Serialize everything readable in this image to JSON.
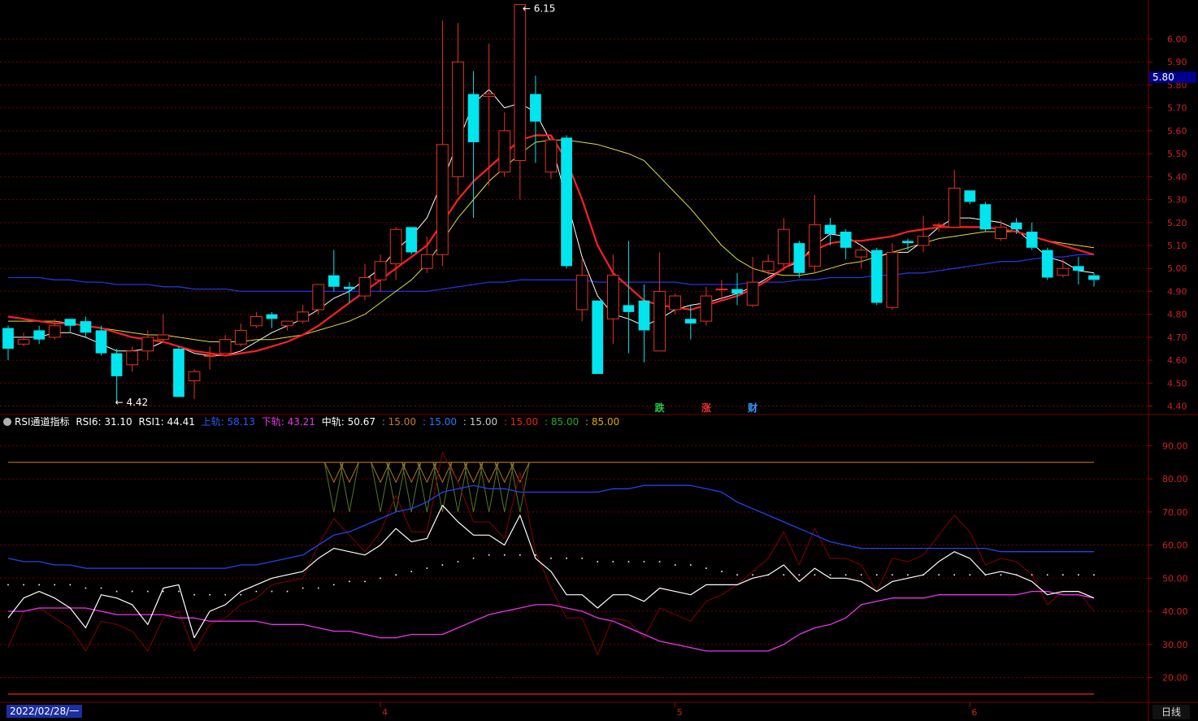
{
  "main": {
    "high_label": "6.15",
    "low_label": "4.42",
    "current_price": "5.80",
    "markers": [
      {
        "text": "跌",
        "color": "#22cc44",
        "index": 42
      },
      {
        "text": "涨",
        "color": "#ee3333",
        "index": 45
      },
      {
        "text": "财",
        "color": "#3399ff",
        "index": 48
      }
    ]
  },
  "indicator": {
    "name": "RSI通道指标",
    "rsi6_label": "RSI6: 31.10",
    "rsi1_label": "RSI1: 44.41",
    "upper_label": "上轨: 58.13",
    "lower_label": "下轨: 43.21",
    "mid_label": "中轨: 50.67",
    "v1": ": 15.00",
    "v2": ": 15.00",
    "v3": ": 15.00",
    "v4": ": 15.00",
    "v5": ": 85.00",
    "v6": ": 85.00"
  },
  "footer": {
    "date": "2022/02/28/一",
    "period": "日线"
  },
  "colors": {
    "up": "#e8331f",
    "down": "#00e5ee",
    "ma_white": "#ffffff",
    "ma_yellow": "#dddd44",
    "ma_red": "#ff2020",
    "ma_blue": "#2233dd",
    "rsi_upper": "#2244ee",
    "rsi_lower": "#ee33ee",
    "rsi6": "#880000",
    "level_85": "#cc8800",
    "grid": "#7a0000"
  },
  "chart_data": [
    {
      "type": "candlestick",
      "y_axis_ticks": [
        "4.40",
        "4.50",
        "4.60",
        "4.70",
        "4.80",
        "4.90",
        "5.00",
        "5.10",
        "5.20",
        "5.30",
        "5.40",
        "5.50",
        "5.60",
        "5.70",
        "5.80",
        "5.90",
        "6.00"
      ],
      "ylim": [
        4.37,
        6.17
      ],
      "x_tick_labels": [
        {
          "label": "4",
          "index": 24
        },
        {
          "label": "5",
          "index": 43
        },
        {
          "label": "6",
          "index": 62
        }
      ],
      "candles": [
        [
          4.74,
          4.65,
          4.75,
          4.6
        ],
        [
          4.67,
          4.69,
          4.72,
          4.66
        ],
        [
          4.73,
          4.69,
          4.75,
          4.67
        ],
        [
          4.7,
          4.75,
          4.78,
          4.69
        ],
        [
          4.78,
          4.75,
          4.78,
          4.72
        ],
        [
          4.77,
          4.72,
          4.79,
          4.7
        ],
        [
          4.73,
          4.63,
          4.75,
          4.62
        ],
        [
          4.63,
          4.53,
          4.65,
          4.42
        ],
        [
          4.58,
          4.64,
          4.66,
          4.55
        ],
        [
          4.64,
          4.7,
          4.73,
          4.6
        ],
        [
          4.69,
          4.71,
          4.8,
          4.68
        ],
        [
          4.65,
          4.44,
          4.66,
          4.44
        ],
        [
          4.51,
          4.55,
          4.56,
          4.43
        ],
        [
          4.62,
          4.62,
          4.66,
          4.56
        ],
        [
          4.63,
          4.69,
          4.71,
          4.63
        ],
        [
          4.67,
          4.73,
          4.76,
          4.66
        ],
        [
          4.75,
          4.79,
          4.81,
          4.74
        ],
        [
          4.8,
          4.78,
          4.81,
          4.74
        ],
        [
          4.75,
          4.77,
          4.77,
          4.73
        ],
        [
          4.77,
          4.81,
          4.84,
          4.76
        ],
        [
          4.82,
          4.93,
          4.93,
          4.8
        ],
        [
          4.97,
          4.92,
          5.08,
          4.9
        ],
        [
          4.92,
          4.91,
          4.94,
          4.85
        ],
        [
          4.88,
          4.96,
          5.02,
          4.86
        ],
        [
          4.95,
          5.03,
          5.06,
          4.9
        ],
        [
          5.02,
          5.17,
          5.18,
          4.95
        ],
        [
          5.18,
          5.07,
          5.18,
          5.06
        ],
        [
          5.0,
          5.06,
          5.14,
          4.98
        ],
        [
          5.06,
          5.54,
          6.08,
          5.01
        ],
        [
          5.4,
          5.9,
          6.07,
          5.32
        ],
        [
          5.76,
          5.55,
          5.86,
          5.22
        ],
        [
          5.75,
          5.76,
          5.98,
          5.36
        ],
        [
          5.42,
          5.6,
          5.68,
          5.4
        ],
        [
          5.47,
          6.15,
          6.15,
          5.3
        ],
        [
          5.76,
          5.64,
          5.84,
          5.46
        ],
        [
          5.42,
          5.56,
          5.58,
          5.39
        ],
        [
          5.57,
          5.01,
          5.58,
          5.0
        ],
        [
          4.82,
          4.97,
          5.04,
          4.77
        ],
        [
          4.86,
          4.54,
          4.86,
          4.54
        ],
        [
          4.78,
          4.97,
          5.06,
          4.67
        ],
        [
          4.84,
          4.81,
          5.12,
          4.63
        ],
        [
          4.86,
          4.73,
          4.93,
          4.59
        ],
        [
          4.64,
          4.9,
          5.07,
          4.64
        ],
        [
          4.82,
          4.88,
          4.89,
          4.8
        ],
        [
          4.78,
          4.76,
          4.84,
          4.69
        ],
        [
          4.77,
          4.88,
          4.92,
          4.75
        ],
        [
          4.91,
          4.91,
          4.95,
          4.86
        ],
        [
          4.91,
          4.89,
          4.98,
          4.84
        ],
        [
          4.84,
          4.94,
          5.05,
          4.83
        ],
        [
          4.99,
          5.03,
          5.06,
          4.97
        ],
        [
          5.02,
          5.17,
          5.22,
          4.99
        ],
        [
          5.11,
          4.98,
          5.12,
          4.96
        ],
        [
          5.01,
          5.19,
          5.32,
          4.98
        ],
        [
          5.19,
          5.15,
          5.22,
          5.1
        ],
        [
          5.16,
          5.09,
          5.17,
          5.04
        ],
        [
          5.05,
          5.08,
          5.1,
          5.0
        ],
        [
          5.08,
          4.85,
          5.09,
          4.84
        ],
        [
          4.83,
          5.07,
          5.11,
          4.82
        ],
        [
          5.12,
          5.11,
          5.13,
          5.08
        ],
        [
          5.1,
          5.14,
          5.23,
          5.07
        ],
        [
          5.19,
          5.19,
          5.2,
          5.16
        ],
        [
          5.18,
          5.35,
          5.43,
          5.18
        ],
        [
          5.34,
          5.29,
          5.34,
          5.28
        ],
        [
          5.28,
          5.17,
          5.29,
          5.16
        ],
        [
          5.13,
          5.18,
          5.21,
          5.12
        ],
        [
          5.2,
          5.17,
          5.22,
          5.15
        ],
        [
          5.16,
          5.09,
          5.2,
          5.08
        ],
        [
          5.08,
          4.96,
          5.09,
          4.95
        ],
        [
          4.97,
          5.0,
          5.04,
          4.96
        ],
        [
          5.01,
          4.99,
          5.05,
          4.93
        ],
        [
          4.97,
          4.95,
          4.98,
          4.92
        ]
      ],
      "ma_white": [
        4.7,
        4.7,
        4.7,
        4.72,
        4.72,
        4.7,
        4.67,
        4.64,
        4.64,
        4.65,
        4.68,
        4.66,
        4.63,
        4.62,
        4.62,
        4.64,
        4.68,
        4.72,
        4.75,
        4.78,
        4.82,
        4.87,
        4.9,
        4.95,
        5.0,
        5.08,
        5.14,
        5.22,
        5.38,
        5.55,
        5.72,
        5.78,
        5.7,
        5.72,
        5.68,
        5.55,
        5.3,
        5.05,
        4.88,
        4.8,
        4.78,
        4.75,
        4.78,
        4.82,
        4.84,
        4.85,
        4.87,
        4.89,
        4.92,
        4.96,
        5.0,
        5.03,
        5.1,
        5.15,
        5.14,
        5.1,
        5.05,
        5.07,
        5.07,
        5.12,
        5.18,
        5.22,
        5.22,
        5.21,
        5.2,
        5.17,
        5.11,
        5.05,
        5.03,
        4.99,
        4.98
      ],
      "ma_yellow": [
        4.77,
        4.77,
        4.77,
        4.77,
        4.76,
        4.75,
        4.74,
        4.73,
        4.72,
        4.71,
        4.71,
        4.7,
        4.69,
        4.68,
        4.68,
        4.68,
        4.69,
        4.69,
        4.7,
        4.71,
        4.73,
        4.75,
        4.77,
        4.8,
        4.85,
        4.9,
        4.95,
        5.02,
        5.12,
        5.22,
        5.3,
        5.38,
        5.44,
        5.5,
        5.55,
        5.56,
        5.56,
        5.55,
        5.54,
        5.52,
        5.5,
        5.47,
        5.4,
        5.33,
        5.26,
        5.18,
        5.1,
        5.04,
        5.0,
        4.98,
        4.97,
        4.97,
        4.98,
        5.0,
        5.02,
        5.03,
        5.05,
        5.07,
        5.09,
        5.11,
        5.13,
        5.14,
        5.15,
        5.16,
        5.16,
        5.16,
        5.14,
        5.12,
        5.11,
        5.1,
        5.09
      ],
      "ma_red": [
        4.79,
        4.78,
        4.77,
        4.76,
        4.76,
        4.75,
        4.74,
        4.72,
        4.7,
        4.69,
        4.68,
        4.66,
        4.64,
        4.63,
        4.62,
        4.63,
        4.64,
        4.66,
        4.68,
        4.71,
        4.75,
        4.8,
        4.85,
        4.9,
        4.95,
        5.0,
        5.05,
        5.1,
        5.2,
        5.3,
        5.38,
        5.44,
        5.5,
        5.56,
        5.58,
        5.58,
        5.47,
        5.3,
        5.1,
        4.98,
        4.92,
        4.86,
        4.84,
        4.83,
        4.82,
        4.84,
        4.86,
        4.88,
        4.91,
        4.95,
        5.0,
        5.04,
        5.08,
        5.11,
        5.12,
        5.12,
        5.13,
        5.14,
        5.16,
        5.17,
        5.18,
        5.18,
        5.18,
        5.18,
        5.17,
        5.16,
        5.14,
        5.12,
        5.1,
        5.08,
        5.06
      ],
      "ma_blue": [
        4.96,
        4.96,
        4.96,
        4.95,
        4.95,
        4.94,
        4.94,
        4.93,
        4.93,
        4.93,
        4.92,
        4.92,
        4.91,
        4.91,
        4.91,
        4.9,
        4.9,
        4.9,
        4.9,
        4.9,
        4.9,
        4.9,
        4.9,
        4.9,
        4.9,
        4.9,
        4.9,
        4.9,
        4.91,
        4.92,
        4.93,
        4.94,
        4.94,
        4.95,
        4.95,
        4.95,
        4.95,
        4.95,
        4.94,
        4.94,
        4.94,
        4.94,
        4.94,
        4.94,
        4.93,
        4.93,
        4.93,
        4.93,
        4.94,
        4.94,
        4.94,
        4.95,
        4.95,
        4.96,
        4.96,
        4.96,
        4.97,
        4.97,
        4.98,
        4.98,
        4.99,
        5.0,
        5.01,
        5.02,
        5.03,
        5.03,
        5.04,
        5.05,
        5.05,
        5.06,
        5.06
      ]
    },
    {
      "type": "line",
      "name": "RSI通道指标",
      "y_axis_ticks": [
        "20.00",
        "30.00",
        "40.00",
        "50.00",
        "60.00",
        "70.00",
        "80.00",
        "90.00"
      ],
      "ylim": [
        13,
        95
      ],
      "rsi1": [
        38,
        44,
        46,
        44,
        41,
        35,
        45,
        44,
        42,
        36,
        47,
        48,
        32,
        40,
        42,
        46,
        48,
        50,
        51,
        52,
        56,
        59,
        58,
        57,
        60,
        65,
        61,
        62,
        72,
        67,
        63,
        63,
        60,
        69,
        56,
        52,
        45,
        45,
        41,
        45,
        45,
        43,
        47,
        46,
        45,
        48,
        48,
        48,
        50,
        51,
        54,
        49,
        53,
        50,
        50,
        49,
        46,
        49,
        50,
        51,
        55,
        58,
        56,
        51,
        52,
        51,
        49,
        45,
        46,
        46,
        44
      ],
      "rsi6": [
        29,
        40,
        41,
        38,
        35,
        28,
        37,
        36,
        34,
        28,
        38,
        40,
        28,
        36,
        38,
        42,
        44,
        48,
        49,
        50,
        60,
        68,
        63,
        58,
        64,
        75,
        64,
        64,
        88,
        79,
        67,
        67,
        62,
        82,
        58,
        47,
        38,
        38,
        27,
        38,
        37,
        32,
        41,
        39,
        37,
        43,
        45,
        48,
        52,
        56,
        64,
        54,
        65,
        56,
        56,
        54,
        46,
        56,
        55,
        57,
        63,
        69,
        64,
        54,
        56,
        55,
        51,
        42,
        46,
        46,
        40
      ],
      "upper": [
        56,
        55,
        55,
        54,
        54,
        53,
        53,
        53,
        53,
        53,
        53,
        53,
        53,
        53,
        53,
        54,
        54,
        55,
        56,
        57,
        60,
        63,
        64,
        66,
        68,
        70,
        71,
        73,
        76,
        77,
        78,
        77,
        77,
        76,
        76,
        76,
        76,
        76,
        76,
        77,
        77,
        78,
        78,
        78,
        78,
        77,
        76,
        73,
        71,
        69,
        67,
        65,
        63,
        61,
        60,
        59,
        59,
        59,
        59,
        59,
        59,
        59,
        59,
        59,
        58,
        58,
        58,
        58,
        58,
        58,
        58
      ],
      "lower": [
        40,
        40,
        41,
        41,
        41,
        41,
        40,
        39,
        39,
        39,
        39,
        38,
        38,
        37,
        37,
        37,
        37,
        36,
        36,
        36,
        35,
        34,
        34,
        33,
        32,
        32,
        33,
        33,
        33,
        35,
        37,
        39,
        40,
        41,
        42,
        42,
        41,
        40,
        38,
        37,
        35,
        33,
        31,
        30,
        29,
        28,
        28,
        28,
        28,
        28,
        30,
        33,
        35,
        36,
        38,
        42,
        43,
        44,
        44,
        44,
        45,
        45,
        45,
        45,
        45,
        45,
        46,
        46,
        45,
        45,
        44
      ],
      "mid": [
        48,
        48,
        48,
        48,
        48,
        47,
        47,
        46,
        46,
        46,
        46,
        46,
        45,
        45,
        45,
        45,
        46,
        46,
        46,
        47,
        47,
        48,
        49,
        49,
        50,
        51,
        52,
        53,
        54,
        55,
        56,
        57,
        57,
        57,
        57,
        56,
        56,
        56,
        55,
        55,
        55,
        55,
        55,
        54,
        54,
        53,
        52,
        51,
        51,
        51,
        51,
        51,
        51,
        51,
        51,
        51,
        51,
        51,
        51,
        51,
        51,
        51,
        51,
        51,
        51,
        51,
        51,
        51,
        51,
        51,
        51
      ],
      "level_85": 85
    }
  ]
}
